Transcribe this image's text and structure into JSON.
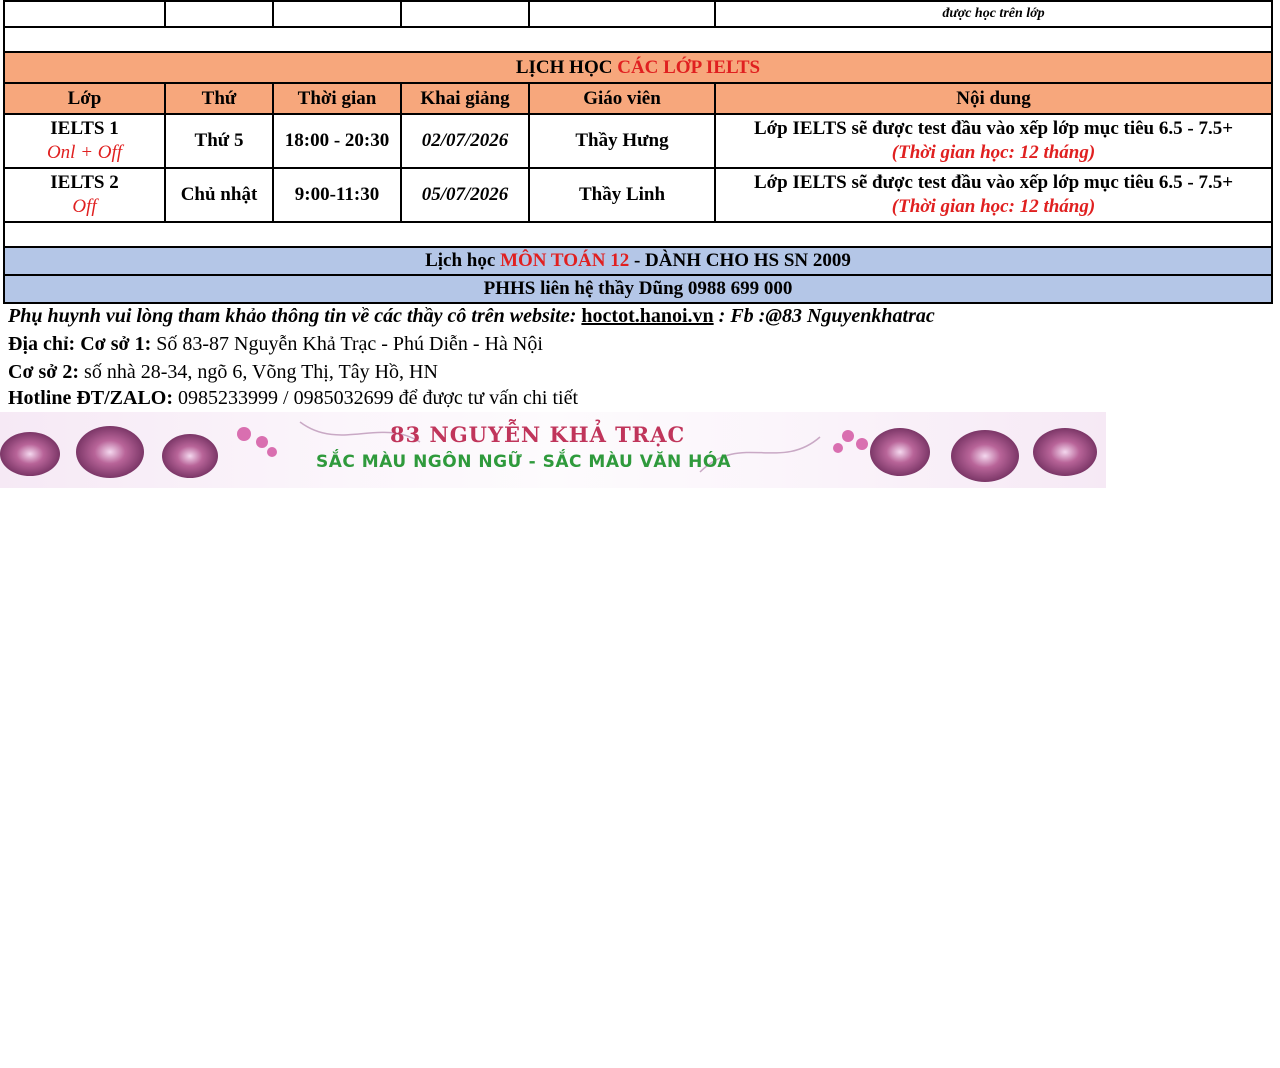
{
  "top_fragment": "được học trên lớp",
  "ielts": {
    "title_black": "LỊCH HỌC",
    "title_red": "CÁC LỚP IELTS",
    "headers": [
      "Lớp",
      "Thứ",
      "Thời gian",
      "Khai giảng",
      "Giáo viên",
      "Nội dung"
    ],
    "rows": [
      {
        "lop": "IELTS 1",
        "mode": "Onl + Off",
        "thu": "Thứ 5",
        "time": "18:00 - 20:30",
        "start": "02/07/2026",
        "teacher": "Thầy Hưng",
        "content": "Lớp IELTS sẽ được test đầu vào xếp lớp mục tiêu 6.5 - 7.5+",
        "duration": "(Thời gian học: 12 tháng)"
      },
      {
        "lop": "IELTS 2",
        "mode": "Off",
        "thu": "Chủ nhật",
        "time": "9:00-11:30",
        "start": "05/07/2026",
        "teacher": "Thầy Linh",
        "content": "Lớp IELTS sẽ được test đầu vào xếp lớp mục tiêu 6.5 - 7.5+",
        "duration": "(Thời gian học: 12 tháng)"
      }
    ]
  },
  "math": {
    "title_black": "Lịch học",
    "title_red": "MÔN TOÁN 12",
    "title_rest": " -  DÀNH CHO HS SN 2009",
    "contact": "PHHS liên hệ thầy Dũng 0988 699 000"
  },
  "footer": {
    "website_prefix": "Phụ huynh vui lòng tham khảo thông tin về các thầy cô trên website: ",
    "website": "hoctot.hanoi.vn",
    "fb": " : Fb :@83 Nguyenkhatrac",
    "addr_label": "Địa chỉ: Cơ sở 1:",
    "addr_1": " Số 83-87 Nguyễn Khả Trạc - Phú Diễn - Hà Nội",
    "addr2_label": "Cơ sở 2:",
    "addr_2": " số nhà 28-34, ngõ 6, Võng Thị, Tây Hồ, HN",
    "hotline_label": "Hotline ĐT/ZALO:",
    "hotline": " 0985233999 / 0985032699 để được tư vấn chi tiết"
  },
  "banner": {
    "line1": "83 NGUYỄN KHẢ TRẠC",
    "line2": "SẮC MÀU NGÔN NGỮ - SẮC MÀU VĂN HÓA"
  },
  "colors": {
    "header_orange": "#f7a77c",
    "math_blue": "#b4c6e7",
    "accent_red": "#e02020"
  }
}
